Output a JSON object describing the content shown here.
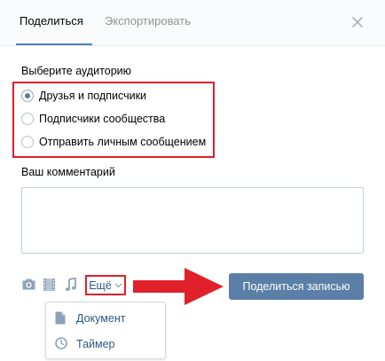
{
  "tabs": {
    "share": "Поделиться",
    "export": "Экспортировать"
  },
  "audience": {
    "label": "Выберите аудиторию",
    "options": [
      {
        "label": "Друзья и подписчики",
        "checked": true
      },
      {
        "label": "Подписчики сообщества",
        "checked": false
      },
      {
        "label": "Отправить личным сообщением",
        "checked": false
      }
    ]
  },
  "comment": {
    "label": "Ваш комментарий",
    "value": ""
  },
  "toolbar": {
    "more_label": "Ещё",
    "icons": [
      "camera-icon",
      "film-icon",
      "music-note-icon",
      "chevron-down-icon"
    ]
  },
  "share_button": {
    "label": "Поделиться записью"
  },
  "dropdown": {
    "items": [
      {
        "label": "Документ",
        "icon": "document-icon"
      },
      {
        "label": "Таймер",
        "icon": "clock-icon"
      }
    ]
  },
  "colors": {
    "accent": "#5181b8",
    "button": "#5b7fa6",
    "highlight": "#e0202a",
    "link": "#2a5885"
  }
}
